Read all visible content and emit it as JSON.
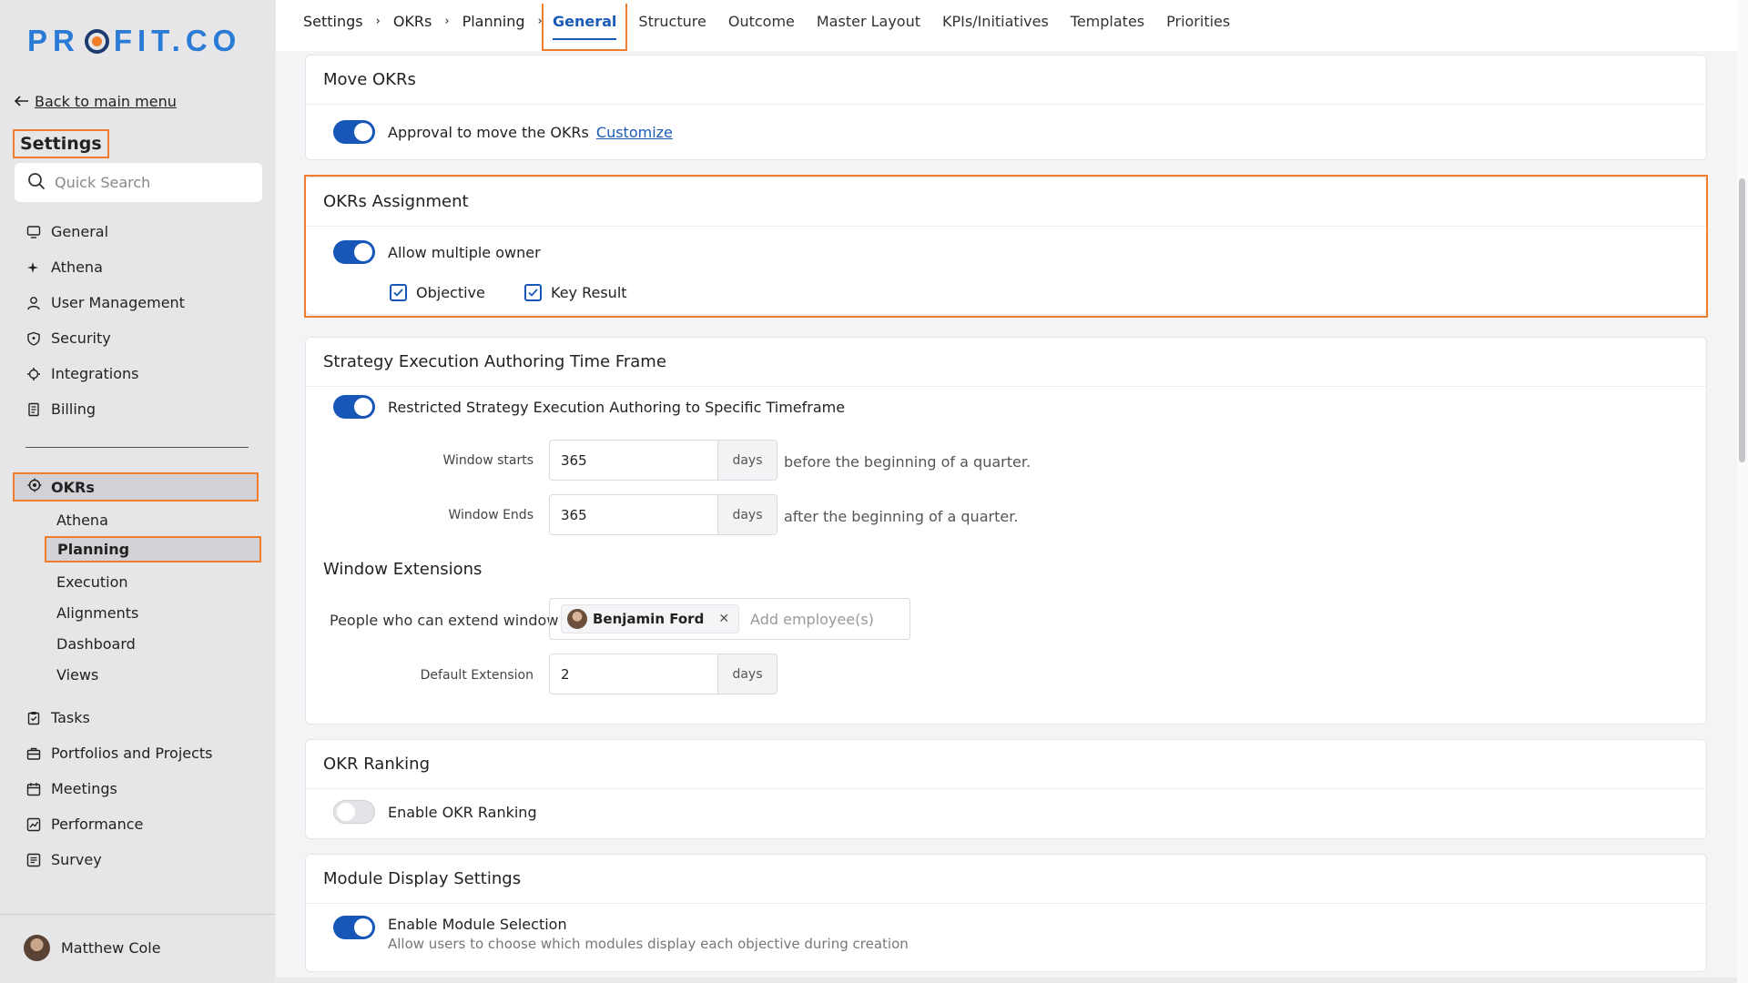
{
  "logo": {
    "pre": "PR",
    "post": "FIT.CO"
  },
  "sidebar": {
    "back_label": "Back to main menu",
    "title": "Settings",
    "search_placeholder": "Quick Search",
    "items": [
      {
        "label": "General",
        "icon": "monitor-icon"
      },
      {
        "label": "Athena",
        "icon": "sparkle-icon"
      },
      {
        "label": "User Management",
        "icon": "user-icon"
      },
      {
        "label": "Security",
        "icon": "shield-icon"
      },
      {
        "label": "Integrations",
        "icon": "gear-icon"
      },
      {
        "label": "Billing",
        "icon": "receipt-icon"
      }
    ],
    "okrs_label": "OKRs",
    "okrs_sub": [
      "Athena",
      "Planning",
      "Execution",
      "Alignments",
      "Dashboard",
      "Views"
    ],
    "bottom_items": [
      {
        "label": "Tasks",
        "icon": "clipboard-icon"
      },
      {
        "label": "Portfolios and Projects",
        "icon": "briefcase-icon"
      },
      {
        "label": "Meetings",
        "icon": "calendar-icon"
      },
      {
        "label": "Performance",
        "icon": "chart-icon"
      },
      {
        "label": "Survey",
        "icon": "survey-icon"
      }
    ],
    "user_name": "Matthew Cole"
  },
  "breadcrumb": [
    "Settings",
    "OKRs",
    "Planning"
  ],
  "tabs": [
    "General",
    "Structure",
    "Outcome",
    "Master Layout",
    "KPIs/Initiatives",
    "Templates",
    "Priorities"
  ],
  "active_tab": "General",
  "move_okrs": {
    "title": "Move OKRs",
    "toggle_label": "Approval to move the OKRs",
    "toggle_on": true,
    "customize": "Customize"
  },
  "okrs_assignment": {
    "title": "OKRs Assignment",
    "toggle_label": "Allow multiple owner",
    "toggle_on": true,
    "checks": [
      "Objective",
      "Key Result"
    ]
  },
  "strategy": {
    "title": "Strategy Execution Authoring Time Frame",
    "toggle_label": "Restricted Strategy Execution Authoring to Specific Timeframe",
    "toggle_on": true,
    "window_starts_label": "Window starts",
    "window_starts_value": "365",
    "window_starts_hint": "before the beginning of a quarter.",
    "window_ends_label": "Window Ends",
    "window_ends_value": "365",
    "window_ends_hint": "after the beginning of a quarter.",
    "unit": "days",
    "extensions_title": "Window Extensions",
    "people_label": "People who can extend window",
    "person": "Benjamin Ford",
    "add_placeholder": "Add employee(s)",
    "default_ext_label": "Default Extension",
    "default_ext_value": "2"
  },
  "ranking": {
    "title": "OKR Ranking",
    "toggle_label": "Enable OKR Ranking",
    "toggle_on": false
  },
  "module_display": {
    "title": "Module Display Settings",
    "toggle_label": "Enable Module Selection",
    "toggle_on": true,
    "description": "Allow users to choose which modules display each objective during creation"
  },
  "colors": {
    "accent": "#1657b8",
    "highlight": "#f07d2a",
    "logo_blue": "#2a7bd6"
  }
}
